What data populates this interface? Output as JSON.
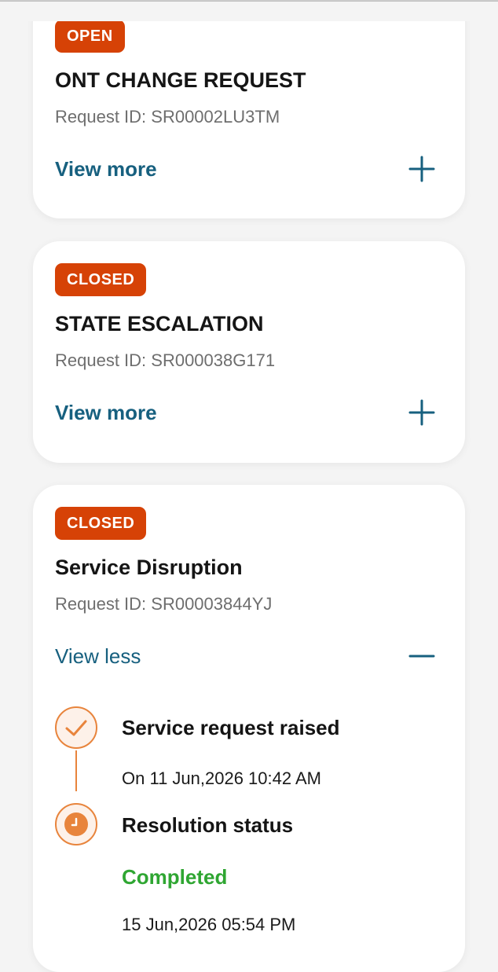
{
  "cards": [
    {
      "status": "OPEN",
      "title": "ONT CHANGE REQUEST",
      "request_id": "Request ID: SR00002LU3TM",
      "toggle_label": "View more"
    },
    {
      "status": "CLOSED",
      "title": "STATE ESCALATION",
      "request_id": "Request ID: SR000038G171",
      "toggle_label": "View more"
    },
    {
      "status": "CLOSED",
      "title": "Service Disruption",
      "request_id": "Request ID: SR00003844YJ",
      "toggle_label": "View less",
      "timeline": [
        {
          "icon": "check-icon",
          "title": "Service request raised",
          "detail": "On 11 Jun,2026 10:42 AM"
        },
        {
          "icon": "clock-icon",
          "title": "Resolution status",
          "status": "Completed",
          "detail": "15 Jun,2026 05:54 PM"
        }
      ]
    }
  ],
  "colors": {
    "badge": "#d64206",
    "link": "#17607f",
    "timeline_accent": "#e8843c",
    "completed": "#2fa632",
    "background": "#f4f4f4"
  }
}
